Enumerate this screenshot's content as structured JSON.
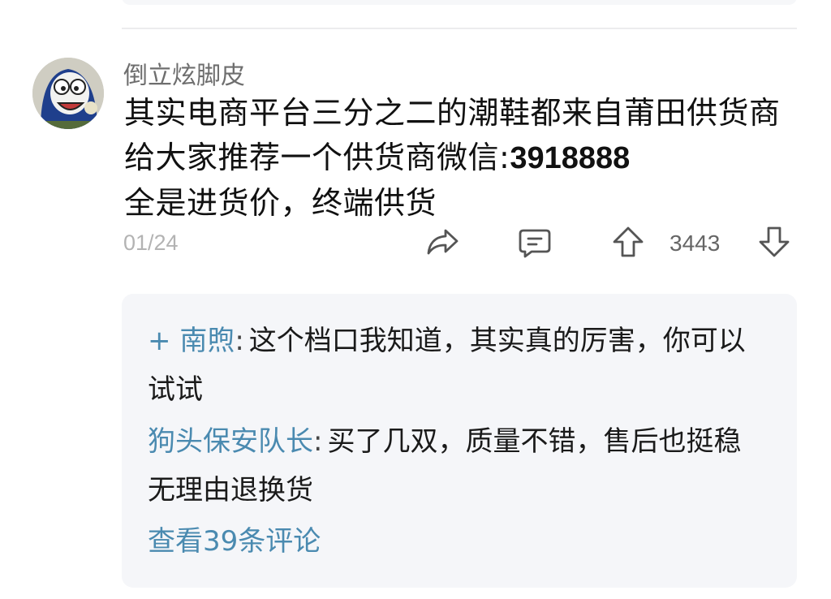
{
  "comment": {
    "username": "倒立炫脚皮",
    "lines": [
      "其实电商平台三分之二的潮鞋都来自莆田供货商",
      "给大家推荐一个供货商微信:"
    ],
    "wechat": "3918888",
    "last_line": "全是进货价，终端供货",
    "date": "01/24",
    "vote_count": "3443"
  },
  "icons": {
    "share": "share-icon",
    "comment": "comment-icon",
    "upvote": "upvote-arrow-icon",
    "downvote": "downvote-arrow-icon"
  },
  "replies": [
    {
      "prefix": "+",
      "author": "南煦",
      "colon": ":",
      "text_line1": "这个档口我知道，其实真的厉害，你可以",
      "text_line2": "试试"
    },
    {
      "author": "狗头保安队长",
      "colon": ":",
      "text_line1": "买了几双，质量不错，售后也挺稳",
      "text_line2": "无理由退换货"
    }
  ],
  "see_more": "查看39条评论",
  "colors": {
    "accent": "#4a8ab0",
    "muted": "#6e6e6e",
    "reply_bg": "#f5f6f9"
  }
}
